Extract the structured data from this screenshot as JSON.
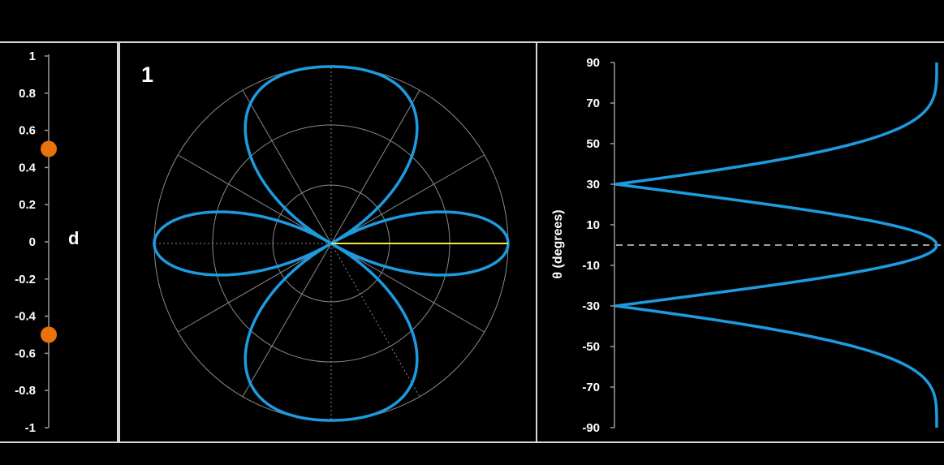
{
  "chart_data": [
    {
      "type": "scatter",
      "title": "",
      "ylabel": "d",
      "ylim": [
        -1,
        1
      ],
      "yticks": [
        "1",
        "0.8",
        "0.6",
        "0.4",
        "0.2",
        "0",
        "-0.2",
        "-0.4",
        "-0.6",
        "-0.8",
        "-1"
      ],
      "ytick_values": [
        1,
        0.8,
        0.6,
        0.4,
        0.2,
        0,
        -0.2,
        -0.4,
        -0.6,
        -0.8,
        -1
      ],
      "points": [
        0.5,
        -0.5
      ],
      "point_color": "#e8720c"
    },
    {
      "type": "line",
      "subtype": "polar",
      "panel_label": "1",
      "curve_color": "#1e9be0",
      "reference_line_color": "#f5e642",
      "grid_color": "#8a8a8a",
      "reference_angle_deg": 0
    },
    {
      "type": "line",
      "ylabel": "θ (degrees)",
      "ylim": [
        -90,
        90
      ],
      "yticks": [
        "90",
        "70",
        "50",
        "30",
        "10",
        "-10",
        "-30",
        "-50",
        "-70",
        "-90"
      ],
      "ytick_values": [
        90,
        70,
        50,
        30,
        10,
        -10,
        -30,
        -50,
        -70,
        -90
      ],
      "reference_theta": 0,
      "nulls_deg": [
        30,
        -30
      ],
      "curve_color": "#1e9be0"
    }
  ]
}
